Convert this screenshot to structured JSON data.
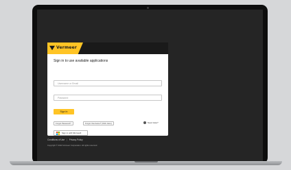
{
  "brand": {
    "name": "Vermeer",
    "color": "#ffc425"
  },
  "login": {
    "title": "Sign in to use available applications",
    "username_placeholder": "Username or Email",
    "password_placeholder": "Password",
    "signin_label": "Sign In",
    "forgot_password_label": "Forgot Password?",
    "forgot_username_label": "Forgot Username? (Click Here)",
    "help_label": "Need Help?",
    "microsoft_label": "Sign in with Microsoft"
  },
  "footer": {
    "terms_label": "Conditions of Use",
    "privacy_label": "Privacy Policy",
    "copyright": "Copyright © 2024 Vermeer Corporation. All rights reserved."
  }
}
